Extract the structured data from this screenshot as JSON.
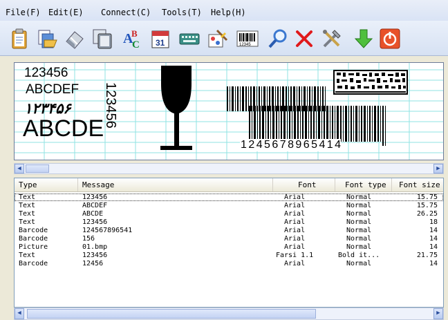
{
  "menu": {
    "items": [
      {
        "label": "File(F)"
      },
      {
        "label": "Edit(E)"
      },
      {
        "label": "Connect(C)"
      },
      {
        "label": "Tools(T)"
      },
      {
        "label": "Help(H)"
      }
    ]
  },
  "toolbar": {
    "buttons": [
      {
        "icon": "clipboard-icon"
      },
      {
        "icon": "open-folder-icon"
      },
      {
        "icon": "eraser-icon"
      },
      {
        "icon": "copy-pages-icon"
      },
      {
        "icon": "spelling-abc-icon"
      },
      {
        "icon": "calendar-icon"
      },
      {
        "icon": "keyboard-icon"
      },
      {
        "icon": "paint-picture-icon"
      },
      {
        "icon": "barcode-icon"
      },
      {
        "icon": "magnifier-icon"
      },
      {
        "icon": "delete-icon"
      },
      {
        "icon": "tools-icon"
      },
      {
        "icon": "download-arrow-icon"
      },
      {
        "icon": "power-icon"
      }
    ],
    "barcode_caption": "12345"
  },
  "canvas": {
    "text1": "123456",
    "text2": "ABCDEF",
    "text3": "١٢٣۴۵۶",
    "text4": "ABCDE",
    "vertical_text": "123456",
    "barcode_human_readable": "1 2 4 5 6 7 8 9 6 5 4 1 4"
  },
  "list": {
    "columns": [
      "Type",
      "Message",
      "Font",
      "Font type",
      "Font size"
    ],
    "rows": [
      {
        "type": "Text",
        "message": "123456",
        "font": "Arial",
        "font_type": "Normal",
        "font_size": "15.75"
      },
      {
        "type": "Text",
        "message": "ABCDEF",
        "font": "Arial",
        "font_type": "Normal",
        "font_size": "15.75"
      },
      {
        "type": "Text",
        "message": "ABCDE",
        "font": "Arial",
        "font_type": "Normal",
        "font_size": "26.25"
      },
      {
        "type": "Text",
        "message": "123456",
        "font": "Arial",
        "font_type": "Normal",
        "font_size": "18"
      },
      {
        "type": "Barcode",
        "message": "124567896541",
        "font": "Arial",
        "font_type": "Normal",
        "font_size": "14"
      },
      {
        "type": "Barcode",
        "message": "156",
        "font": "Arial",
        "font_type": "Normal",
        "font_size": "14"
      },
      {
        "type": "Picture",
        "message": "01.bmp",
        "font": "Arial",
        "font_type": "Normal",
        "font_size": "14"
      },
      {
        "type": "Text",
        "message": "123456",
        "font": "Farsi 1.1",
        "font_type": "Bold it...",
        "font_size": "21.75"
      },
      {
        "type": "Barcode",
        "message": "12456",
        "font": "Arial",
        "font_type": "Normal",
        "font_size": "14"
      }
    ]
  },
  "colors": {
    "grid_line": "#8fe3e3",
    "canvas_bg": "#ffffff",
    "accent_blue": "#2f5fbd"
  }
}
